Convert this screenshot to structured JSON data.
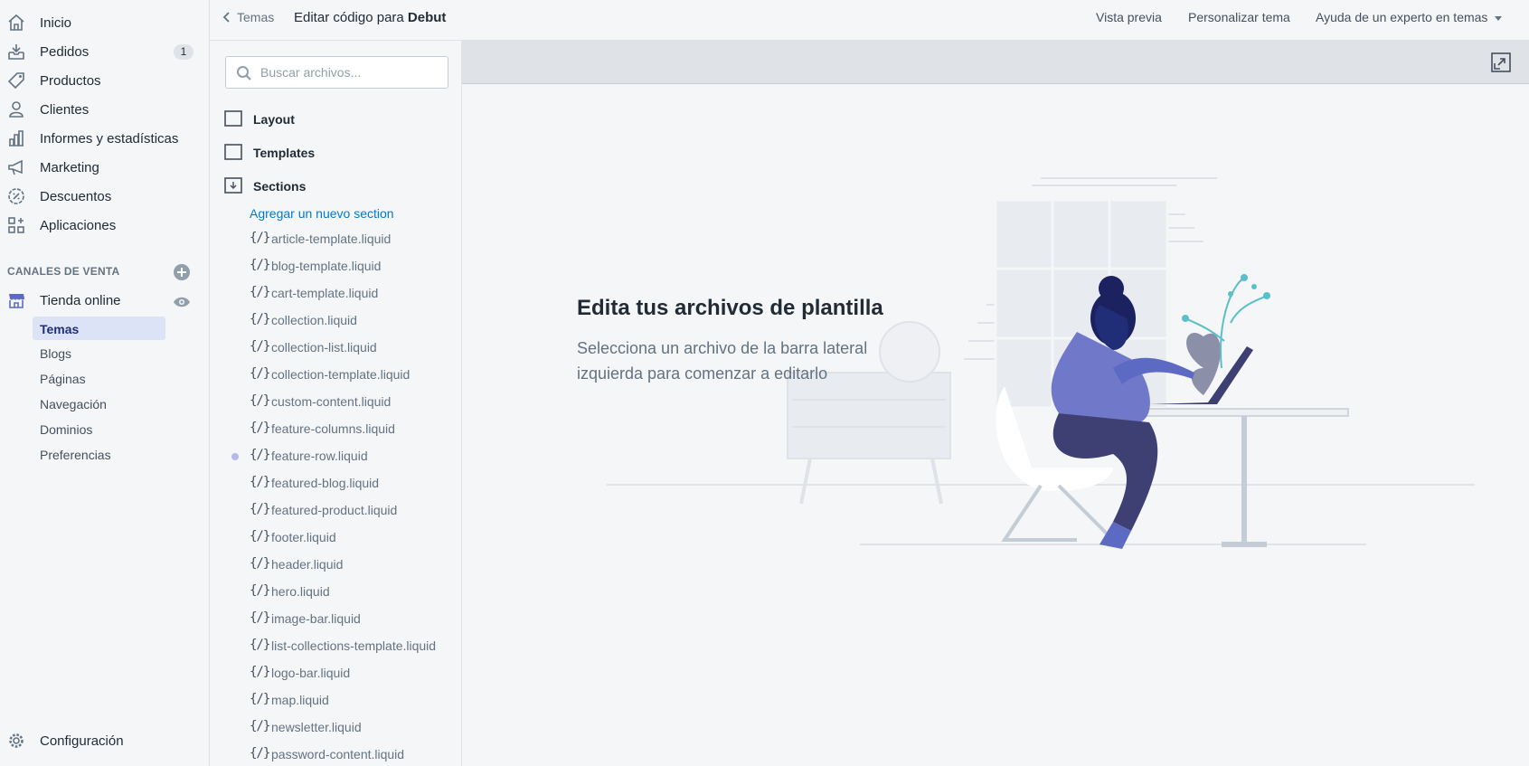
{
  "sidebar": {
    "items": [
      {
        "label": "Inicio",
        "icon": "home-icon"
      },
      {
        "label": "Pedidos",
        "icon": "orders-icon",
        "badge": "1"
      },
      {
        "label": "Productos",
        "icon": "tag-icon"
      },
      {
        "label": "Clientes",
        "icon": "person-icon"
      },
      {
        "label": "Informes y estadísticas",
        "icon": "bar-chart-icon"
      },
      {
        "label": "Marketing",
        "icon": "megaphone-icon"
      },
      {
        "label": "Descuentos",
        "icon": "discount-icon"
      },
      {
        "label": "Aplicaciones",
        "icon": "apps-icon"
      }
    ],
    "sales_channels_heading": "CANALES DE VENTA",
    "online_store": {
      "label": "Tienda online",
      "icon": "store-icon"
    },
    "online_store_sub": [
      {
        "label": "Temas",
        "active": true
      },
      {
        "label": "Blogs"
      },
      {
        "label": "Páginas"
      },
      {
        "label": "Navegación"
      },
      {
        "label": "Dominios"
      },
      {
        "label": "Preferencias"
      }
    ],
    "settings": {
      "label": "Configuración",
      "icon": "gear-icon"
    }
  },
  "topbar": {
    "back_label": "Temas",
    "title_prefix": "Editar código para",
    "theme_name": "Debut",
    "preview": "Vista previa",
    "customize": "Personalizar tema",
    "expert_help": "Ayuda de un experto en temas"
  },
  "files": {
    "search_placeholder": "Buscar archivos...",
    "folders": [
      {
        "label": "Layout",
        "open": false
      },
      {
        "label": "Templates",
        "open": false
      },
      {
        "label": "Sections",
        "open": true
      }
    ],
    "add_section": "Agregar un nuevo section",
    "file_prefix": "{/}",
    "sections": [
      {
        "name": "article-template.liquid"
      },
      {
        "name": "blog-template.liquid"
      },
      {
        "name": "cart-template.liquid"
      },
      {
        "name": "collection.liquid"
      },
      {
        "name": "collection-list.liquid"
      },
      {
        "name": "collection-template.liquid"
      },
      {
        "name": "custom-content.liquid"
      },
      {
        "name": "feature-columns.liquid"
      },
      {
        "name": "feature-row.liquid",
        "modified": true
      },
      {
        "name": "featured-blog.liquid"
      },
      {
        "name": "featured-product.liquid"
      },
      {
        "name": "footer.liquid"
      },
      {
        "name": "header.liquid"
      },
      {
        "name": "hero.liquid"
      },
      {
        "name": "image-bar.liquid"
      },
      {
        "name": "list-collections-template.liquid"
      },
      {
        "name": "logo-bar.liquid"
      },
      {
        "name": "map.liquid"
      },
      {
        "name": "newsletter.liquid"
      },
      {
        "name": "password-content.liquid"
      }
    ]
  },
  "editor": {
    "empty_title": "Edita tus archivos de plantilla",
    "empty_text": "Selecciona un archivo de la barra lateral izquierda para comenzar a editarlo"
  },
  "colors": {
    "accent": "#5c6ac4",
    "link": "#007ace",
    "active_bg": "#dde3f7",
    "active_text": "#202e78"
  }
}
